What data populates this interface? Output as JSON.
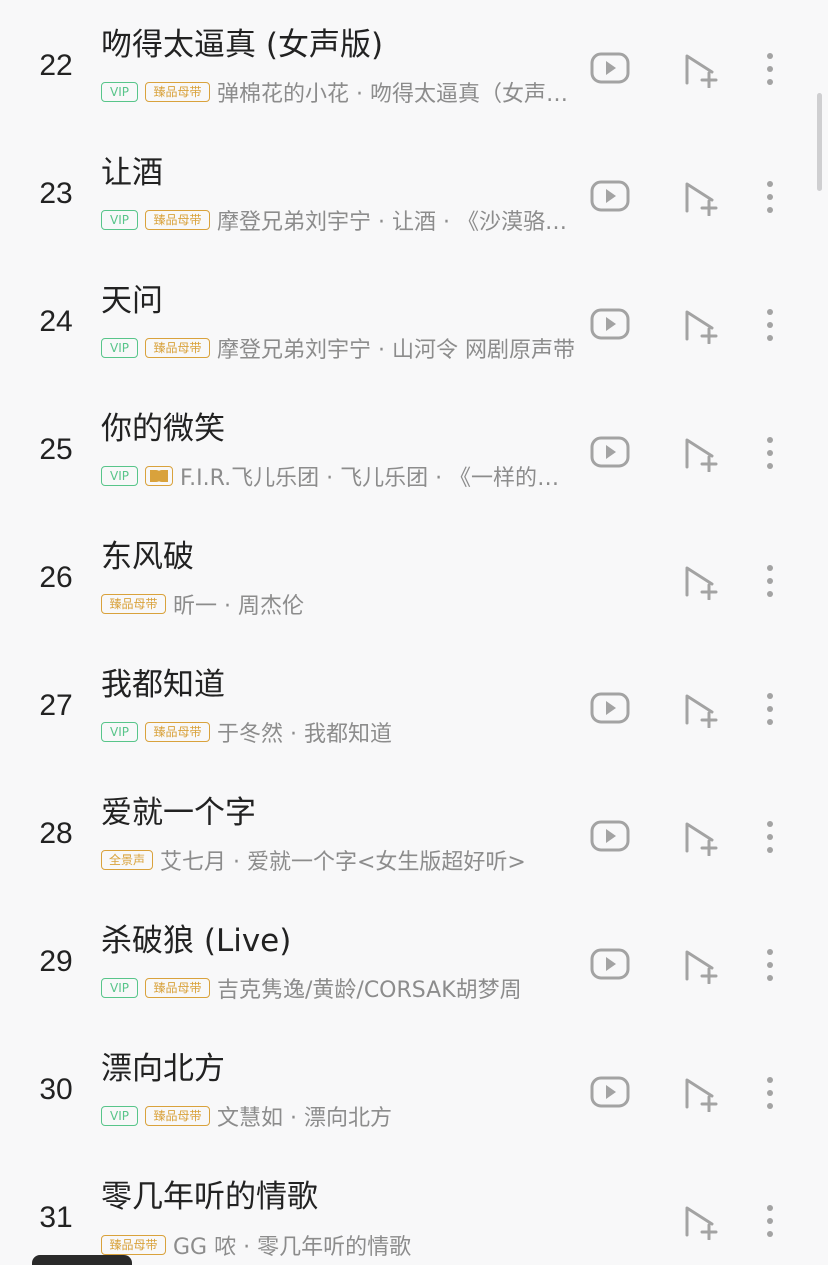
{
  "colors": {
    "vip_green": "#58c58a",
    "gold": "#d9a23c",
    "text_primary": "#222222",
    "text_secondary": "#8c8c8c",
    "icon_gray": "#a3a3a3",
    "background": "#f8f8f9"
  },
  "icons": {
    "mv": "play-video-icon",
    "add": "add-to-playlist-icon",
    "more": "more-vertical-icon",
    "dolby": "dolby-audio-icon"
  },
  "songs": [
    {
      "num": "22",
      "title": "吻得太逼真 (女声版)",
      "tags": [
        "VIP",
        "臻品母带"
      ],
      "subtitle": "弹棉花的小花 · 吻得太逼真（女声版）",
      "has_mv": true
    },
    {
      "num": "23",
      "title": "让酒",
      "tags": [
        "VIP",
        "臻品母带"
      ],
      "subtitle": "摩登兄弟刘宇宁 · 让酒 · 《沙漠骆驼》",
      "has_mv": true
    },
    {
      "num": "24",
      "title": "天问",
      "tags": [
        "VIP",
        "臻品母带"
      ],
      "subtitle": "摩登兄弟刘宇宁 · 山河令 网剧原声带",
      "has_mv": true
    },
    {
      "num": "25",
      "title": "你的微笑",
      "tags": [
        "VIP",
        "dolby"
      ],
      "subtitle": "F.I.R.飞儿乐团 · 飞儿乐团 · 《一样的月光》",
      "has_mv": true
    },
    {
      "num": "26",
      "title": "东风破",
      "tags": [
        "臻品母带"
      ],
      "subtitle": "昕一 · 周杰伦",
      "has_mv": false
    },
    {
      "num": "27",
      "title": "我都知道",
      "tags": [
        "VIP",
        "臻品母带"
      ],
      "subtitle": "于冬然 · 我都知道",
      "has_mv": true
    },
    {
      "num": "28",
      "title": "爱就一个字",
      "tags": [
        "全景声"
      ],
      "subtitle": "艾七月 · 爱就一个字<女生版超好听>",
      "has_mv": true
    },
    {
      "num": "29",
      "title": "杀破狼 (Live)",
      "tags": [
        "VIP",
        "臻品母带"
      ],
      "subtitle": "吉克隽逸/黄龄/CORSAK胡梦周",
      "has_mv": true
    },
    {
      "num": "30",
      "title": "漂向北方",
      "tags": [
        "VIP",
        "臻品母带"
      ],
      "subtitle": "文慧如 · 漂向北方",
      "has_mv": true
    },
    {
      "num": "31",
      "title": "零几年听的情歌",
      "tags": [
        "臻品母带"
      ],
      "subtitle": "GG 哝 · 零几年听的情歌",
      "has_mv": false
    }
  ]
}
